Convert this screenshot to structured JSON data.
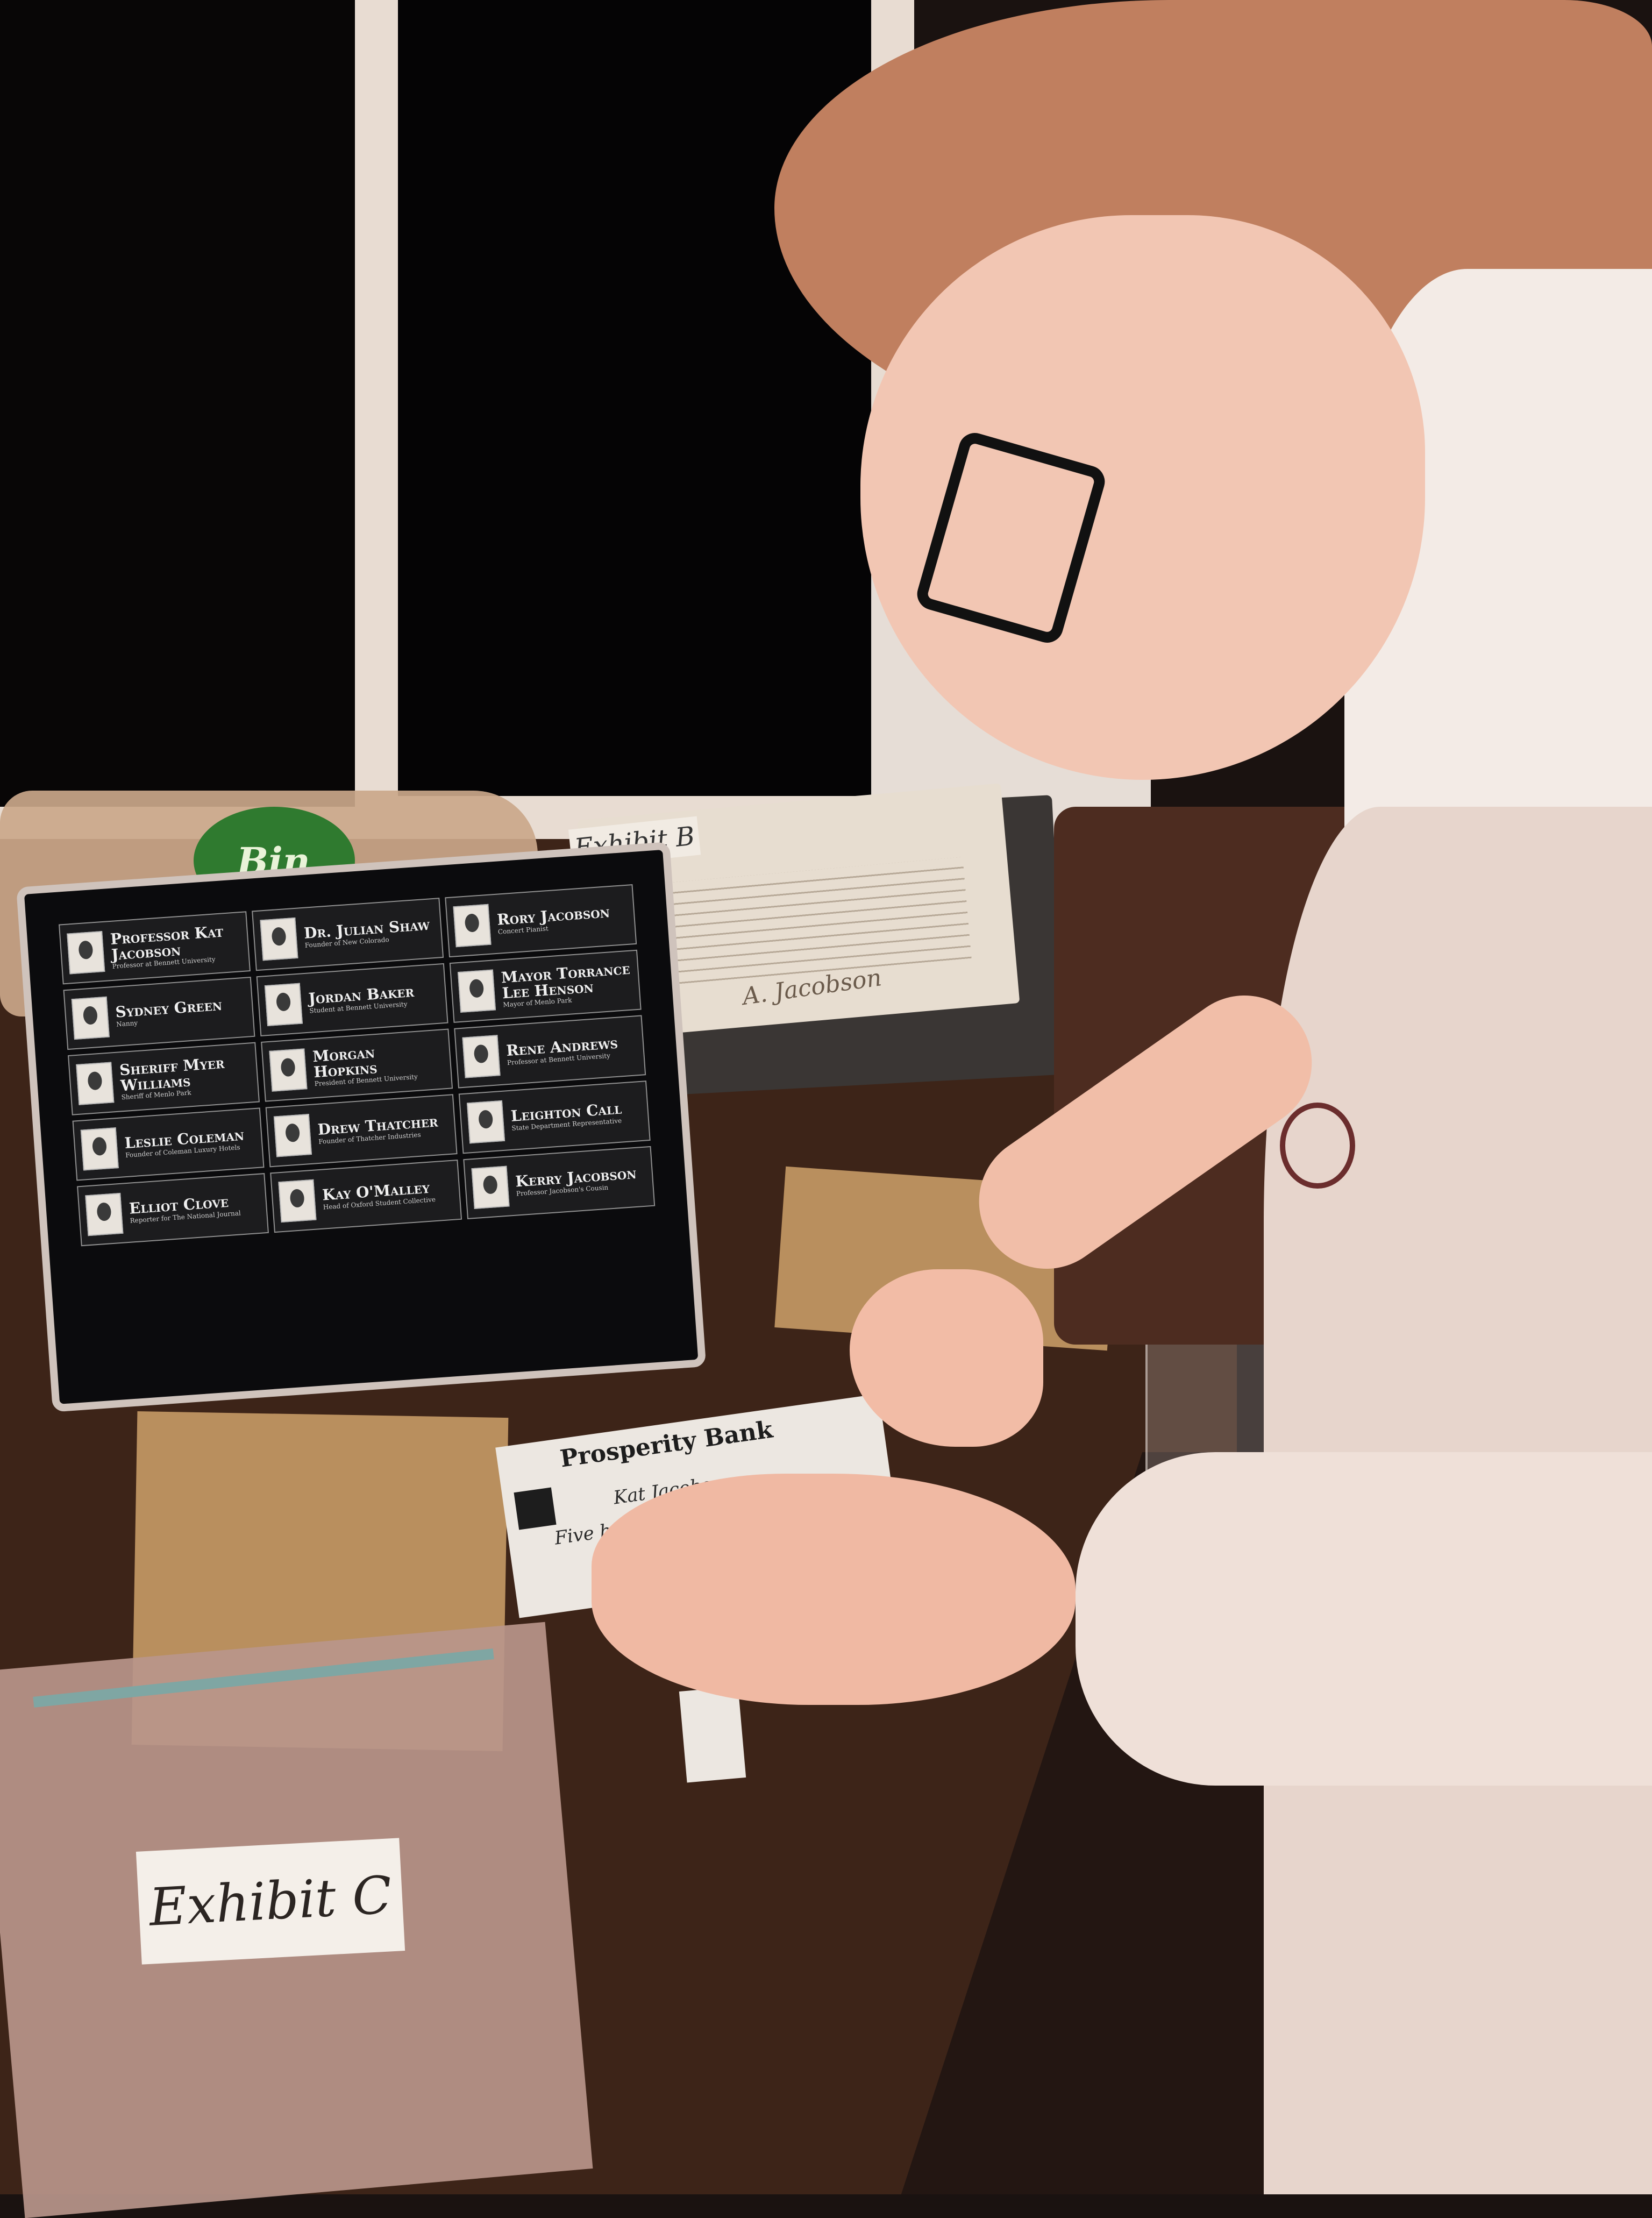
{
  "tablet": {
    "characters": [
      {
        "name": "Professor Kat Jacobson",
        "role": "Professor at Bennett University"
      },
      {
        "name": "Dr. Julian Shaw",
        "role": "Founder of New Colorado"
      },
      {
        "name": "Rory Jacobson",
        "role": "Concert Pianist"
      },
      {
        "name": "Sydney Green",
        "role": "Nanny"
      },
      {
        "name": "Jordan Baker",
        "role": "Student at Bennett University"
      },
      {
        "name": "Mayor Torrance Lee Henson",
        "role": "Mayor of Menlo Park"
      },
      {
        "name": "Sheriff Myer Williams",
        "role": "Sheriff of Menlo Park"
      },
      {
        "name": "Morgan Hopkins",
        "role": "President of Bennett University"
      },
      {
        "name": "Rene Andrews",
        "role": "Professor at Bennett University"
      },
      {
        "name": "Leslie Coleman",
        "role": "Founder of Coleman Luxury Hotels"
      },
      {
        "name": "Drew Thatcher",
        "role": "Founder of Thatcher Industries"
      },
      {
        "name": "Leighton Call",
        "role": "State Department Representative"
      },
      {
        "name": "Elliot Clove",
        "role": "Reporter for The National Journal"
      },
      {
        "name": "Kay O'Malley",
        "role": "Head of Oxford Student Collective"
      },
      {
        "name": "Kerry Jacobson",
        "role": "Professor Jacobson's Cousin"
      }
    ]
  },
  "exhibit_b": {
    "label": "Exhibit B",
    "signature": "A. Jacobson"
  },
  "check": {
    "bank": "Prosperity Bank",
    "payee": "Kat Jacobson",
    "amount": "Five hundred tho"
  },
  "exhibit_c": {
    "label": "Exhibit C"
  },
  "bread_bag": {
    "brand": "Bin"
  }
}
